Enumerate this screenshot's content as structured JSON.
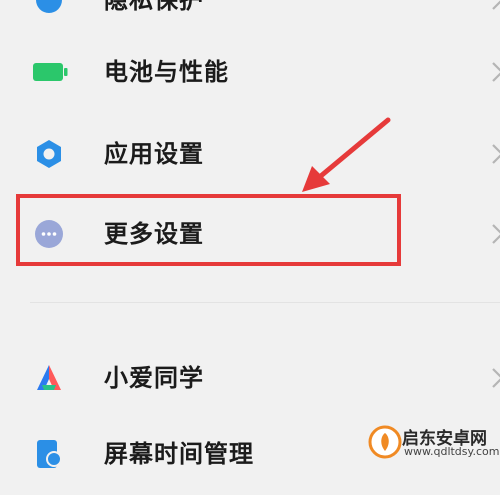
{
  "settings_list": {
    "items": [
      {
        "label": "隐私保护",
        "icon": "privacy-icon"
      },
      {
        "label": "电池与性能",
        "icon": "battery-icon"
      },
      {
        "label": "应用设置",
        "icon": "gear-icon"
      },
      {
        "label": "更多设置",
        "icon": "more-dots-icon"
      },
      {
        "label": "小爱同学",
        "icon": "xiaoai-assistant-icon"
      },
      {
        "label": "屏幕时间管理",
        "icon": "screen-time-icon"
      }
    ]
  },
  "annotation": {
    "highlighted_item": "更多设置",
    "color": "#e63a3a"
  },
  "watermark": {
    "title": "启东安卓网",
    "url": "www.qdltdsy.com"
  },
  "colors": {
    "background": "#f1f1f1",
    "battery": "#2bc76b",
    "gear": "#2b8fe6",
    "more": "#9aa7d8"
  }
}
